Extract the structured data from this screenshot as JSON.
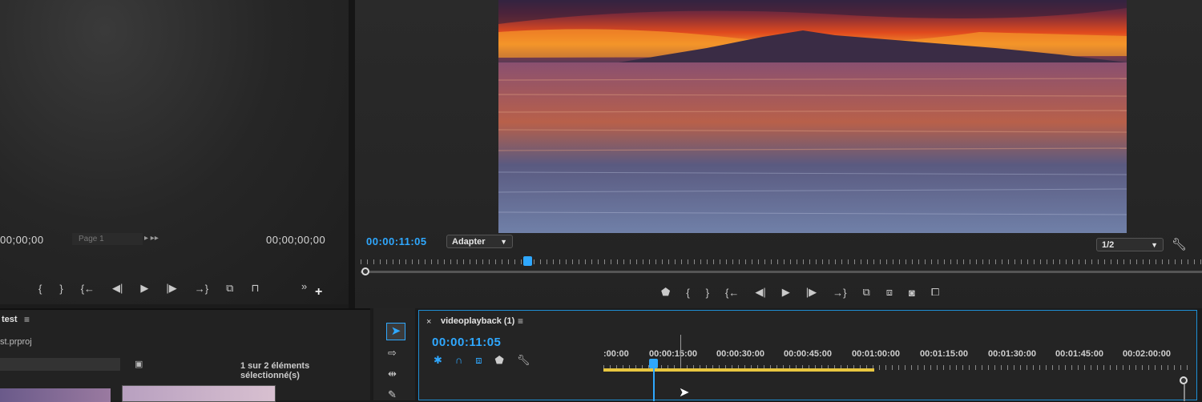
{
  "source_monitor": {
    "timecode_in": "00;00;00",
    "page_label": "Page 1",
    "timecode_out": "00;00;00;00",
    "controls": [
      "{",
      "}",
      "{←",
      "◀|",
      "▶",
      "|▶",
      "→}",
      "⧉",
      "⊓",
      "»",
      "+"
    ]
  },
  "program_monitor": {
    "timecode": "00:00:11:05",
    "fit_select": "Adapter",
    "resolution_select": "1/2",
    "controls": [
      "marker",
      "{",
      "}",
      "{←",
      "◀|",
      "▶",
      "|▶",
      "→}",
      "insert",
      "overwrite",
      "camera",
      "compare"
    ]
  },
  "project_panel": {
    "title": "test",
    "file": "st.prproj",
    "selection_status": "1 sur 2 éléments sélectionné(s)"
  },
  "timeline": {
    "tab_title": "videoplayback (1)",
    "timecode": "00:00:11:05",
    "ruler_labels": [
      ":00:00",
      "00:00:15:00",
      "00:00:30:00",
      "00:00:45:00",
      "00:01:00:00",
      "00:01:15:00",
      "00:01:30:00",
      "00:01:45:00",
      "00:02:00:00"
    ],
    "playhead_seconds": 11.2
  },
  "colors": {
    "accent_blue": "#2fa8ff",
    "timeline_border": "#1e8fd6",
    "work_area": "#e8c640"
  }
}
